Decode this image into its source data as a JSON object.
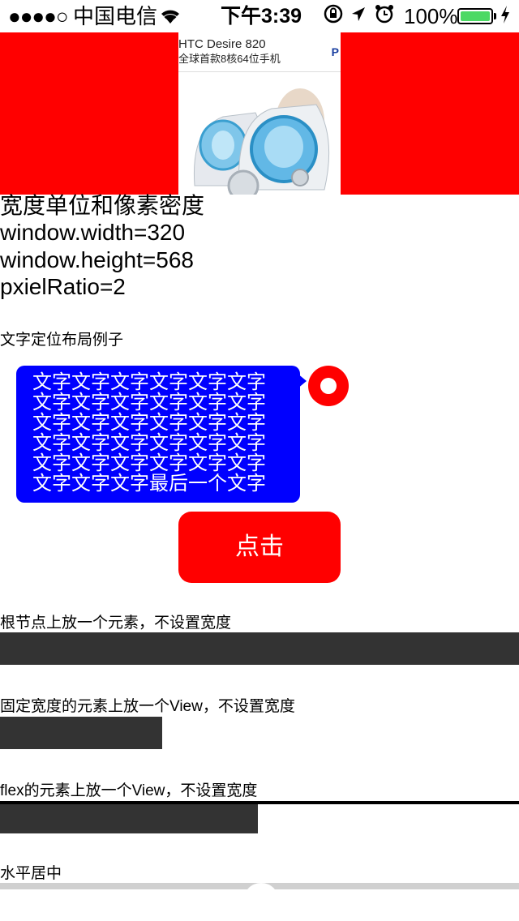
{
  "status_bar": {
    "signal_dots": "●●●●○",
    "carrier": "中国电信",
    "time": "下午3:39",
    "battery_percent": "100%",
    "icons": [
      "wifi-icon",
      "rotation-lock-icon",
      "location-arrow-icon",
      "alarm-icon",
      "battery-icon",
      "charging-icon"
    ]
  },
  "banner": {
    "ad_title": "HTC Desire 820",
    "ad_subtitle": "全球首款8核64位手机",
    "ad_logo": "P"
  },
  "info": {
    "heading": "宽度单位和像素密度",
    "width_line": "window.width=320",
    "height_line": "window.height=568",
    "ratio_line": "pxielRatio=2"
  },
  "text_layout": {
    "label": "文字定位布局例子",
    "bubble_text": "文字文字文字文字文字文字文字文字文字文字文字文字文字文字文字文字文字文字文字文字文字文字文字文字文字文字文字文字文字文字文字文字文字最后一个文字"
  },
  "button": {
    "label": "点击"
  },
  "sections": {
    "root_label": "根节点上放一个元素，不设置宽度",
    "fixed_label": "固定宽度的元素上放一个View，不设置宽度",
    "flex_label": "flex的元素上放一个View，不设置宽度",
    "center_label": "水平居中"
  },
  "colors": {
    "red": "#ff0000",
    "blue": "#0000ff",
    "dark_bar": "#333333",
    "battery_green": "#4cd964"
  }
}
